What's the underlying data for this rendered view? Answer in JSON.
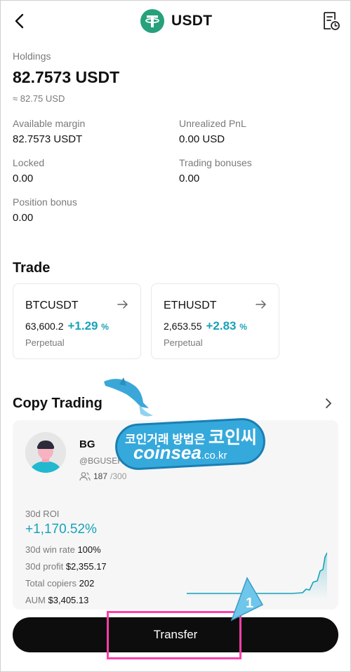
{
  "header": {
    "title": "USDT",
    "back_icon": "chevron-left-icon",
    "history_icon": "document-clock-icon"
  },
  "holdings": {
    "label": "Holdings",
    "amount": "82.7573 USDT",
    "usd": "≈ 82.75 USD"
  },
  "stats": {
    "available_margin_label": "Available margin",
    "available_margin_value": "82.7573 USDT",
    "unrealized_pnl_label": "Unrealized PnL",
    "unrealized_pnl_value": "0.00 USD",
    "locked_label": "Locked",
    "locked_value": "0.00",
    "trading_bonuses_label": "Trading bonuses",
    "trading_bonuses_value": "0.00",
    "position_bonus_label": "Position bonus",
    "position_bonus_value": "0.00"
  },
  "trade": {
    "title": "Trade",
    "cards": [
      {
        "symbol": "BTCUSDT",
        "price": "63,600.2",
        "change": "+1.29",
        "unit": "%",
        "kind": "Perpetual"
      },
      {
        "symbol": "ETHUSDT",
        "price": "2,653.55",
        "change": "+2.83",
        "unit": "%",
        "kind": "Perpetual"
      }
    ]
  },
  "copy_trading": {
    "title": "Copy Trading",
    "trader": {
      "name": "BG",
      "handle": "@BGUSER-",
      "copiers_current": "187",
      "copiers_max": "/300"
    },
    "roi_label": "30d ROI",
    "roi_value": "+1,170.52%",
    "win_rate_label": "30d win rate",
    "win_rate_value": "100%",
    "profit_label": "30d profit",
    "profit_value": "$2,355.17",
    "copiers_label": "Total copiers",
    "copiers_value": "202",
    "aum_label": "AUM",
    "aum_value": "$3,405.13"
  },
  "watermark": {
    "korean_small": "코인거래 방법은",
    "korean_big": "코인씨",
    "english": "coinsea",
    "domain": ".co.kr"
  },
  "transfer": {
    "label": "Transfer"
  },
  "annotation": {
    "step": "1"
  },
  "colors": {
    "tether_green": "#26a17b",
    "accent_teal": "#17a2b8",
    "highlight_pink": "#ff3fa8"
  }
}
